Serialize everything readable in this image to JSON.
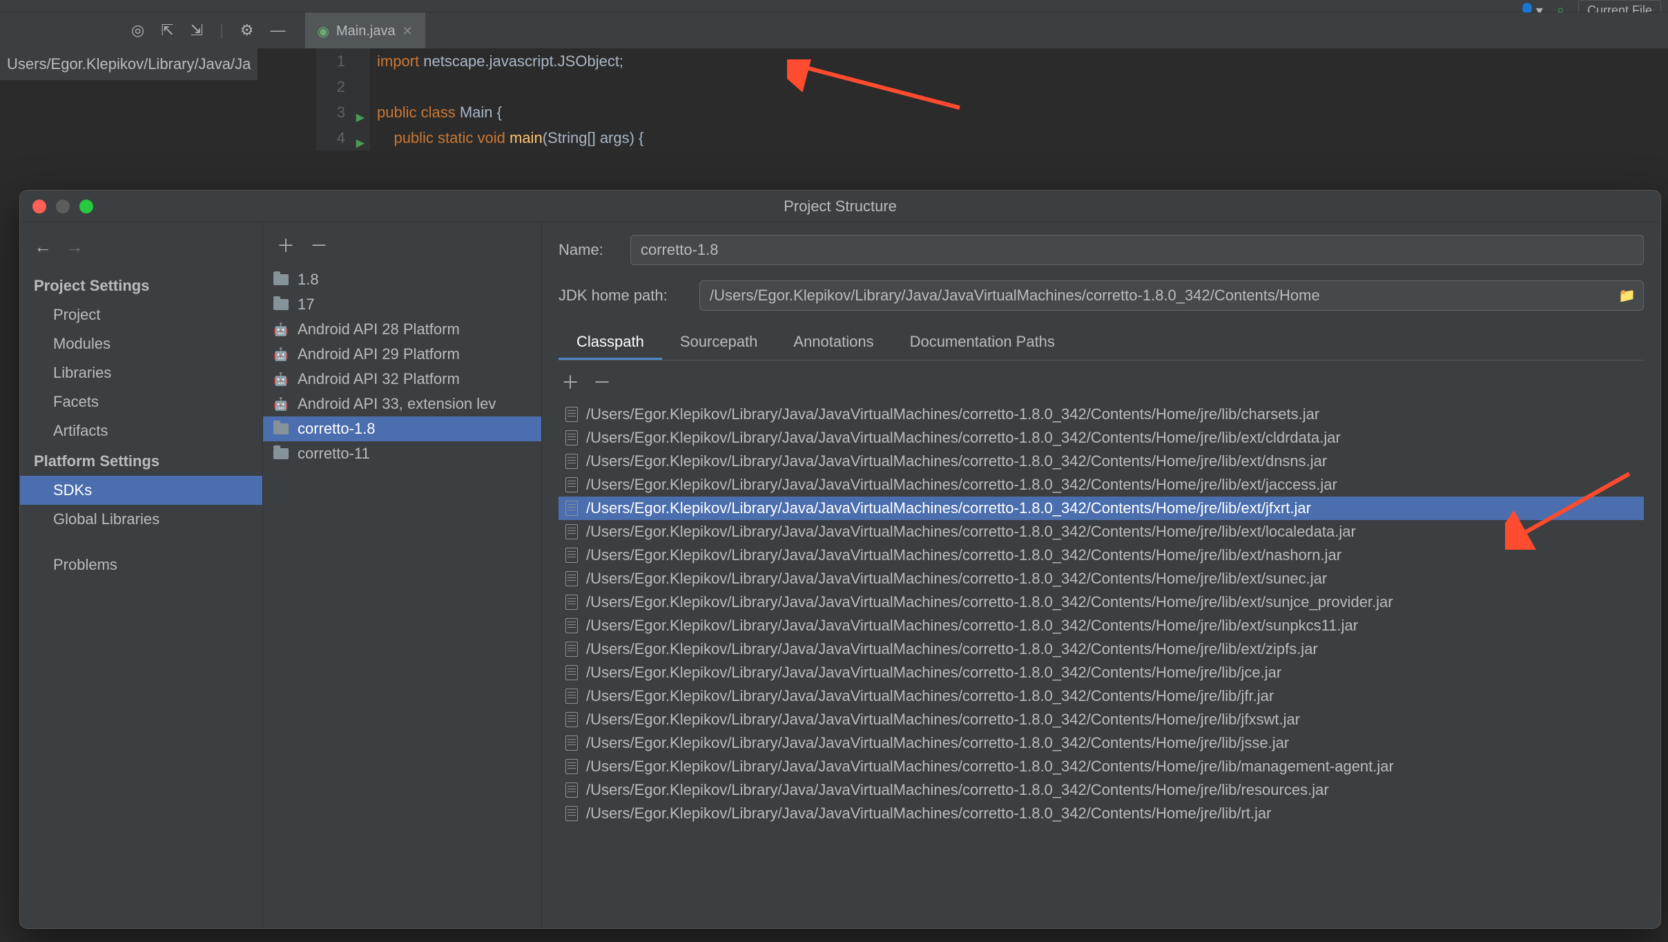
{
  "topbar": {
    "search_label": "Current File"
  },
  "editor": {
    "tab_label": "Main.java",
    "breadcrumb": "Users/Egor.Klepikov/Library/Java/Ja",
    "lines": [
      {
        "n": "1",
        "html": "<span class='kw'>import</span> netscape.javascript.JSObject;"
      },
      {
        "n": "2",
        "html": ""
      },
      {
        "n": "3",
        "html": "<span class='kw'>public class</span> <span class='cls'>Main</span> {",
        "run": true
      },
      {
        "n": "4",
        "html": "    <span class='kw'>public static void</span> <span class='fn'>main</span>(String[] args) {",
        "run": true
      }
    ]
  },
  "dialog": {
    "title": "Project Structure",
    "nav": {
      "project_settings_label": "Project Settings",
      "project_settings": [
        "Project",
        "Modules",
        "Libraries",
        "Facets",
        "Artifacts"
      ],
      "platform_settings_label": "Platform Settings",
      "platform_settings": [
        "SDKs",
        "Global Libraries"
      ],
      "problems_label": "Problems",
      "selected": "SDKs"
    },
    "sdks": {
      "items": [
        {
          "label": "1.8",
          "icon": "folder"
        },
        {
          "label": "17",
          "icon": "folder"
        },
        {
          "label": "Android API 28 Platform",
          "icon": "android"
        },
        {
          "label": "Android API 29 Platform",
          "icon": "android"
        },
        {
          "label": "Android API 32 Platform",
          "icon": "android"
        },
        {
          "label": "Android API 33, extension lev",
          "icon": "android"
        },
        {
          "label": "corretto-1.8",
          "icon": "folder",
          "selected": true
        },
        {
          "label": "corretto-11",
          "icon": "folder"
        }
      ]
    },
    "detail": {
      "name_label": "Name:",
      "name_value": "corretto-1.8",
      "path_label": "JDK home path:",
      "path_value": "/Users/Egor.Klepikov/Library/Java/JavaVirtualMachines/corretto-1.8.0_342/Contents/Home",
      "tabs": [
        "Classpath",
        "Sourcepath",
        "Annotations",
        "Documentation Paths"
      ],
      "active_tab": "Classpath",
      "classpath": [
        "/Users/Egor.Klepikov/Library/Java/JavaVirtualMachines/corretto-1.8.0_342/Contents/Home/jre/lib/charsets.jar",
        "/Users/Egor.Klepikov/Library/Java/JavaVirtualMachines/corretto-1.8.0_342/Contents/Home/jre/lib/ext/cldrdata.jar",
        "/Users/Egor.Klepikov/Library/Java/JavaVirtualMachines/corretto-1.8.0_342/Contents/Home/jre/lib/ext/dnsns.jar",
        "/Users/Egor.Klepikov/Library/Java/JavaVirtualMachines/corretto-1.8.0_342/Contents/Home/jre/lib/ext/jaccess.jar",
        "/Users/Egor.Klepikov/Library/Java/JavaVirtualMachines/corretto-1.8.0_342/Contents/Home/jre/lib/ext/jfxrt.jar",
        "/Users/Egor.Klepikov/Library/Java/JavaVirtualMachines/corretto-1.8.0_342/Contents/Home/jre/lib/ext/localedata.jar",
        "/Users/Egor.Klepikov/Library/Java/JavaVirtualMachines/corretto-1.8.0_342/Contents/Home/jre/lib/ext/nashorn.jar",
        "/Users/Egor.Klepikov/Library/Java/JavaVirtualMachines/corretto-1.8.0_342/Contents/Home/jre/lib/ext/sunec.jar",
        "/Users/Egor.Klepikov/Library/Java/JavaVirtualMachines/corretto-1.8.0_342/Contents/Home/jre/lib/ext/sunjce_provider.jar",
        "/Users/Egor.Klepikov/Library/Java/JavaVirtualMachines/corretto-1.8.0_342/Contents/Home/jre/lib/ext/sunpkcs11.jar",
        "/Users/Egor.Klepikov/Library/Java/JavaVirtualMachines/corretto-1.8.0_342/Contents/Home/jre/lib/ext/zipfs.jar",
        "/Users/Egor.Klepikov/Library/Java/JavaVirtualMachines/corretto-1.8.0_342/Contents/Home/jre/lib/jce.jar",
        "/Users/Egor.Klepikov/Library/Java/JavaVirtualMachines/corretto-1.8.0_342/Contents/Home/jre/lib/jfr.jar",
        "/Users/Egor.Klepikov/Library/Java/JavaVirtualMachines/corretto-1.8.0_342/Contents/Home/jre/lib/jfxswt.jar",
        "/Users/Egor.Klepikov/Library/Java/JavaVirtualMachines/corretto-1.8.0_342/Contents/Home/jre/lib/jsse.jar",
        "/Users/Egor.Klepikov/Library/Java/JavaVirtualMachines/corretto-1.8.0_342/Contents/Home/jre/lib/management-agent.jar",
        "/Users/Egor.Klepikov/Library/Java/JavaVirtualMachines/corretto-1.8.0_342/Contents/Home/jre/lib/resources.jar",
        "/Users/Egor.Klepikov/Library/Java/JavaVirtualMachines/corretto-1.8.0_342/Contents/Home/jre/lib/rt.jar"
      ],
      "classpath_selected_index": 4
    }
  }
}
